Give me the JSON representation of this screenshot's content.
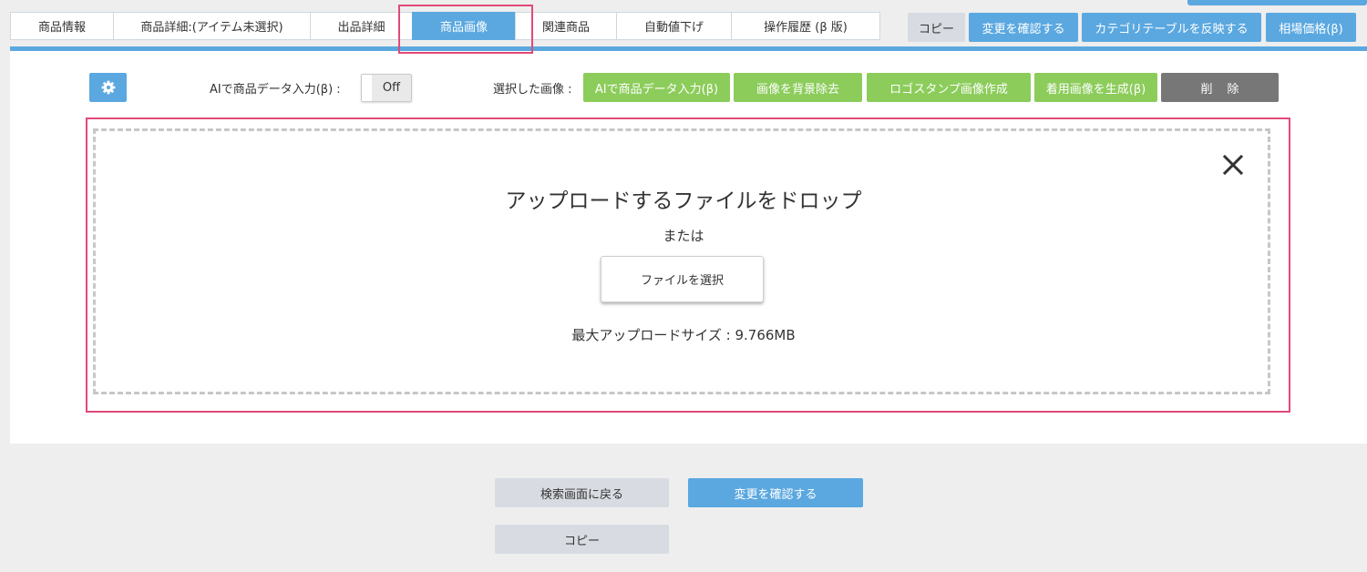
{
  "tabs": [
    {
      "label": "商品情報"
    },
    {
      "label": "商品詳細:(アイテム未選択)"
    },
    {
      "label": "出品詳細"
    },
    {
      "label": "商品画像"
    },
    {
      "label": "関連商品"
    },
    {
      "label": "自動値下げ"
    },
    {
      "label": "操作履歴 (β 版)"
    }
  ],
  "active_tab": "商品画像",
  "header_buttons": {
    "copy": "コピー",
    "confirm": "変更を確認する",
    "apply_category": "カテゴリテーブルを反映する",
    "market_price": "相場価格(β)"
  },
  "toolbar": {
    "settings_icon": "gear-icon",
    "ai_input_label": "AIで商品データ入力(β) :",
    "ai_toggle_value": "Off",
    "selected_images_label": "選択した画像 :",
    "ai_input_button": "AIで商品データ入力(β)",
    "remove_bg_button": "画像を背景除去",
    "logo_stamp_button": "ロゴスタンプ画像作成",
    "wear_image_button": "着用画像を生成(β)",
    "delete_button": "削除"
  },
  "dropzone": {
    "title": "アップロードするファイルをドロップ",
    "or_text": "または",
    "select_button": "ファイルを選択",
    "max_size_text": "最大アップロードサイズ : 9.766MB",
    "close_icon": "close-icon"
  },
  "footer": {
    "back_button": "検索画面に戻る",
    "confirm_button": "変更を確認する",
    "copy_button": "コピー"
  },
  "colors": {
    "primary_blue": "#5ba8e0",
    "action_green": "#8ccc5b",
    "delete_gray": "#777777",
    "highlight_pink": "#e04a78"
  }
}
